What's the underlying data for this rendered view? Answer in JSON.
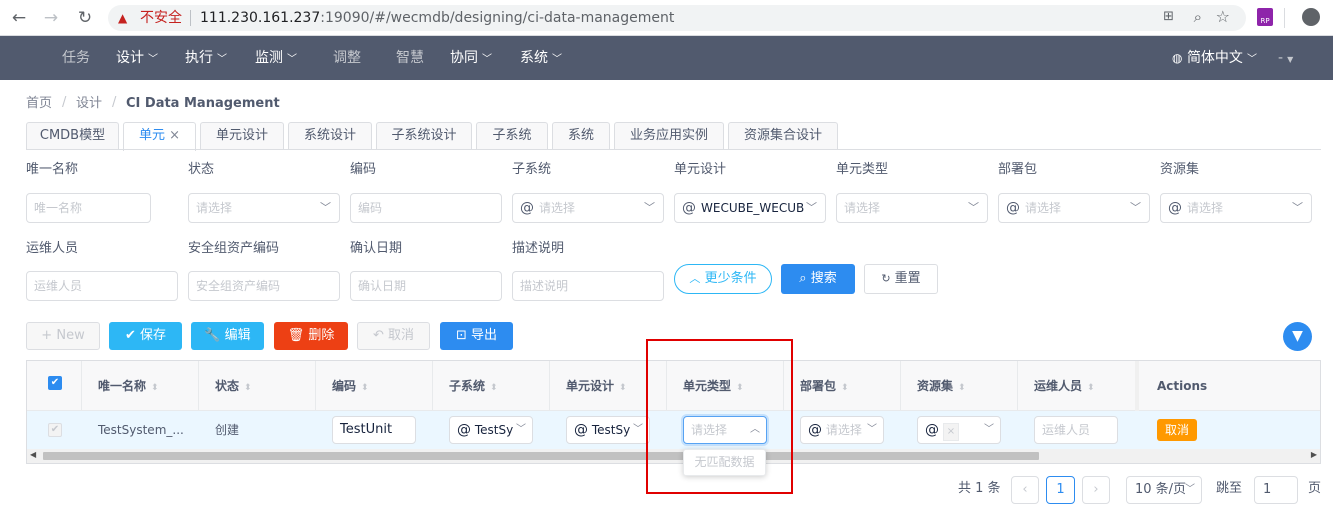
{
  "browser": {
    "insecure_label": "不安全",
    "url_host": "111.230.161.237",
    "url_rest": ":19090/#/wecmdb/designing/ci-data-management",
    "ext_label": "RP"
  },
  "topnav": {
    "items": [
      "任务",
      "设计",
      "执行",
      "监测",
      "调整",
      "智慧",
      "协同",
      "系统"
    ],
    "language": "简体中文",
    "user": "-"
  },
  "breadcrumb": {
    "home": "首页",
    "design": "设计",
    "current": "CI Data Management"
  },
  "tabs": [
    "CMDB模型",
    "单元",
    "单元设计",
    "系统设计",
    "子系统设计",
    "子系统",
    "系统",
    "业务应用实例",
    "资源集合设计"
  ],
  "tab_close": "×",
  "filters": {
    "labels_row1": [
      "唯一名称",
      "状态",
      "编码",
      "子系统",
      "单元设计",
      "单元类型",
      "部署包",
      "资源集"
    ],
    "placeholders_row1": [
      "唯一名称",
      "请选择",
      "编码",
      "请选择",
      "",
      "请选择",
      "请选择",
      "请选择"
    ],
    "unit_design_value": "WECUBE_WECUBE",
    "labels_row2": [
      "运维人员",
      "安全组资产编码",
      "确认日期",
      "描述说明"
    ],
    "placeholders_row2": [
      "运维人员",
      "安全组资产编码",
      "确认日期",
      "描述说明"
    ],
    "at_symbol": "@",
    "less_conditions": "更少条件",
    "search": "搜索",
    "reset": "重置"
  },
  "toolbar": {
    "new": "New",
    "save": "保存",
    "edit": "编辑",
    "delete": "删除",
    "cancel": "取消",
    "export": "导出"
  },
  "table": {
    "headers": [
      "唯一名称",
      "状态",
      "编码",
      "子系统",
      "单元设计",
      "单元类型",
      "部署包",
      "资源集",
      "运维人员",
      "Actions"
    ],
    "row": {
      "name": "TestSystem_...",
      "status": "创建",
      "code": "TestUnit",
      "subsystem": "TestSy",
      "unit_design": "TestSy",
      "unit_type_placeholder": "请选择",
      "deploy_placeholder": "请选择",
      "resource_clear": "×",
      "ops_placeholder": "运维人员",
      "action": "取消"
    },
    "dropdown_empty": "无匹配数据"
  },
  "pager": {
    "total": "共 1 条",
    "current_page": "1",
    "page_size": "10 条/页",
    "jump_label": "跳至",
    "jump_value": "1",
    "page_unit": "页"
  },
  "colors": {
    "nav_bg": "#515a6e",
    "primary": "#2d8cf0",
    "danger": "#ed4014",
    "warning": "#ff9900",
    "highlight_box": "#e00000"
  }
}
